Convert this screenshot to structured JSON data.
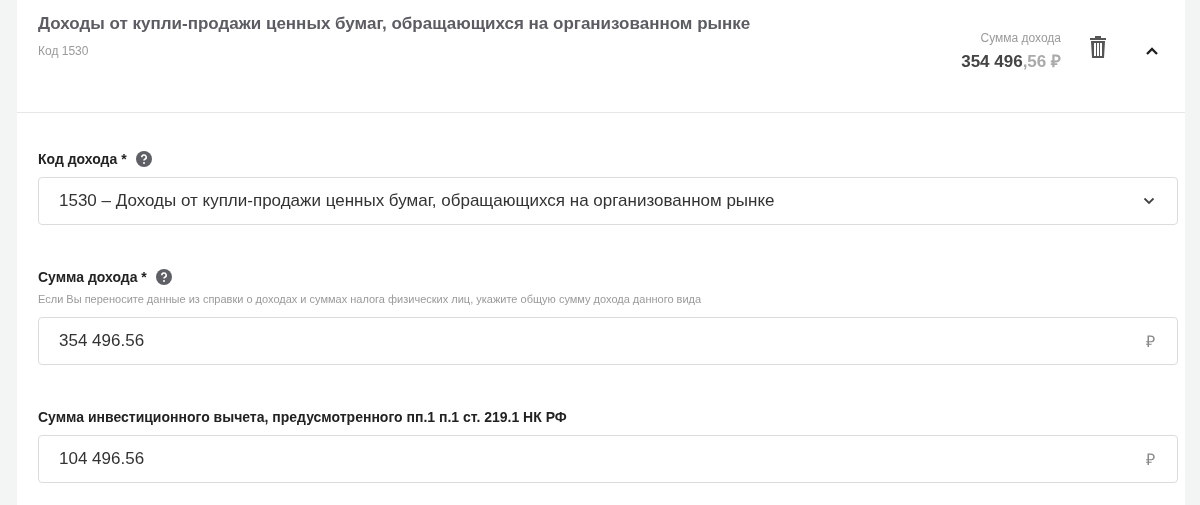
{
  "header": {
    "title": "Доходы от купли-продажи ценных бумаг, обращающихся на организованном рынке",
    "code": "Код 1530",
    "sum_label": "Сумма дохода",
    "sum_whole": "354 496",
    "sum_fraction": ",56 ₽",
    "expanded": true
  },
  "fields": [
    {
      "kind": "select",
      "label": "Код дохода *",
      "help": true,
      "value": "1530 – Доходы от купли-продажи ценных бумаг, обращающихся на организованном рынке"
    },
    {
      "kind": "money",
      "label": "Сумма дохода *",
      "help": true,
      "hint": "Если Вы переносите данные из справки о доходах и суммах налога физических лиц, укажите общую сумму дохода данного вида",
      "value": "354 496.56",
      "currency": "₽"
    },
    {
      "kind": "money",
      "label": "Сумма инвестиционного вычета, предусмотренного пп.1 п.1 ст. 219.1 НК РФ",
      "help": false,
      "value": "104 496.56",
      "currency": "₽"
    }
  ]
}
